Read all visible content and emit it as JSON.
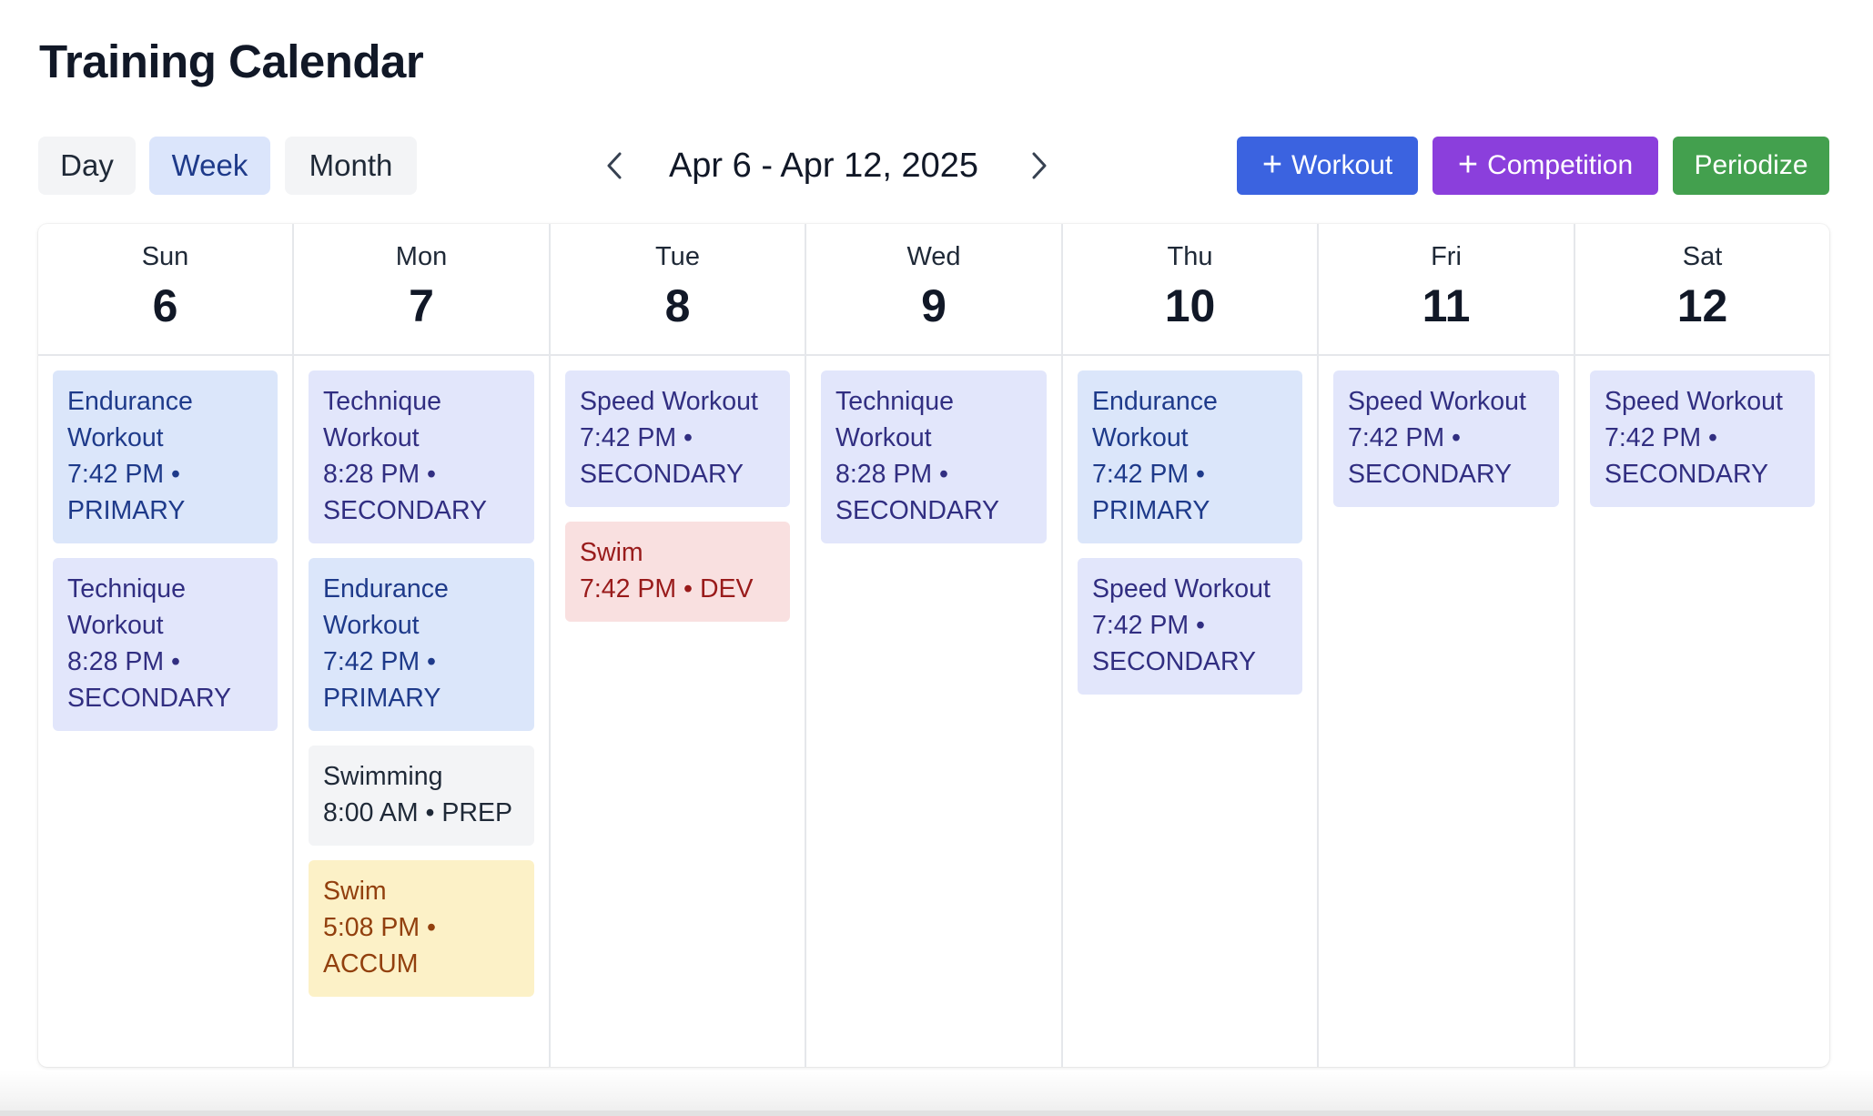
{
  "app": {
    "title": "Training Calendar"
  },
  "toolbar": {
    "views": [
      {
        "label": "Day",
        "active": false
      },
      {
        "label": "Week",
        "active": true
      },
      {
        "label": "Month",
        "active": false
      }
    ],
    "date_range": "Apr 6 - Apr 12, 2025",
    "prev_icon": "chevron-left-icon",
    "next_icon": "chevron-right-icon",
    "actions": {
      "workout_label": "Workout",
      "competition_label": "Competition",
      "periodize_label": "Periodize"
    }
  },
  "colors": {
    "workout_button": "#3b63e0",
    "competition_button": "#8b3fdc",
    "periodize_button": "#43a04e",
    "active_view": "#dbe5fb"
  },
  "days": [
    {
      "dow": "Sun",
      "date": "6",
      "events": [
        {
          "title": "Endurance Workout",
          "meta": "7:42 PM • PRIMARY",
          "kind": "primary"
        },
        {
          "title": "Technique Workout",
          "meta": "8:28 PM • SECONDARY",
          "kind": "secondary"
        }
      ]
    },
    {
      "dow": "Mon",
      "date": "7",
      "events": [
        {
          "title": "Technique Workout",
          "meta": "8:28 PM • SECONDARY",
          "kind": "secondary"
        },
        {
          "title": "Endurance Workout",
          "meta": "7:42 PM • PRIMARY",
          "kind": "primary"
        },
        {
          "title": "Swimming",
          "meta": "8:00 AM • PREP",
          "kind": "prep"
        },
        {
          "title": "Swim",
          "meta": "5:08 PM • ACCUM",
          "kind": "accum"
        }
      ]
    },
    {
      "dow": "Tue",
      "date": "8",
      "events": [
        {
          "title": "Speed Workout",
          "meta": "7:42 PM • SECONDARY",
          "kind": "secondary"
        },
        {
          "title": "Swim",
          "meta": "7:42 PM • DEV",
          "kind": "dev"
        }
      ]
    },
    {
      "dow": "Wed",
      "date": "9",
      "events": [
        {
          "title": "Technique Workout",
          "meta": "8:28 PM • SECONDARY",
          "kind": "secondary"
        }
      ]
    },
    {
      "dow": "Thu",
      "date": "10",
      "events": [
        {
          "title": "Endurance Workout",
          "meta": "7:42 PM • PRIMARY",
          "kind": "primary"
        },
        {
          "title": "Speed Workout",
          "meta": "7:42 PM • SECONDARY",
          "kind": "secondary"
        }
      ]
    },
    {
      "dow": "Fri",
      "date": "11",
      "events": [
        {
          "title": "Speed Workout",
          "meta": "7:42 PM • SECONDARY",
          "kind": "secondary"
        }
      ]
    },
    {
      "dow": "Sat",
      "date": "12",
      "events": [
        {
          "title": "Speed Workout",
          "meta": "7:42 PM • SECONDARY",
          "kind": "secondary"
        }
      ]
    }
  ]
}
